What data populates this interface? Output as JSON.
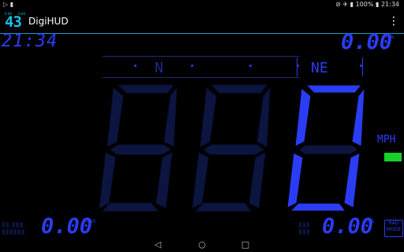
{
  "status_bar": {
    "left_icons": "▷ ▮",
    "right_text": "⊘ ✈ ▮ 100% ▮ 21:34",
    "battery": "100%",
    "time": "21:34"
  },
  "app_bar": {
    "icon_mini_left": "0.00",
    "icon_mini_right": "0.00",
    "icon_number": "43",
    "title": "DigiHUD",
    "menu_icon": "⋮"
  },
  "clock": "21:34",
  "trip_top": {
    "value": "0.00",
    "units": "MIN\nMI"
  },
  "compass": {
    "marks": [
      "N",
      "NE"
    ]
  },
  "speed": {
    "value": "0",
    "units": "MPH"
  },
  "bottom_left": {
    "value": "0.00",
    "units": "MAX"
  },
  "bottom_right": {
    "value": "0.00",
    "units": "AVG"
  },
  "mode_button": {
    "line1": "RAD",
    "line2": "MODE"
  },
  "colors": {
    "segment_on": "#2b3cf5",
    "segment_off": "#0c1440",
    "accent": "#18a0c6",
    "indicator": "#18d02a"
  },
  "nav_bar": {
    "back": "◁",
    "home": "○",
    "recents": "□"
  }
}
